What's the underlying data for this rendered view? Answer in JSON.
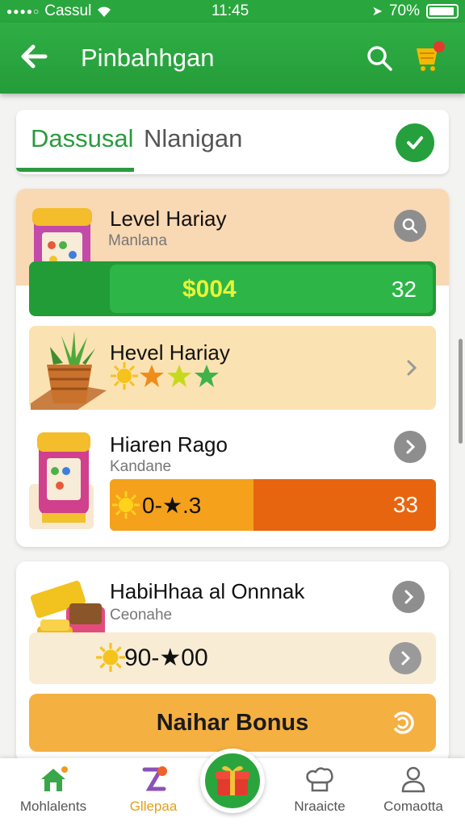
{
  "status_bar": {
    "carrier": "Cassul",
    "time": "11:45",
    "battery": "70%"
  },
  "app_bar": {
    "title": "Pinbahhgan",
    "icons": [
      "back-arrow-icon",
      "search-icon",
      "cart-icon"
    ]
  },
  "tabs": {
    "active": "Dassusal",
    "other": "Nlanigan"
  },
  "levels": [
    {
      "title": "Level Hariay",
      "subtitle": "Manlana",
      "amount": "$004",
      "count": "32"
    },
    {
      "title": "Hevel Hariay",
      "stars": 4
    },
    {
      "title": "Hiaren Rago",
      "subtitle": "Kandane",
      "reward": "0-★.3",
      "count": "33"
    }
  ],
  "offer": {
    "title": "HabiHhaa al Onnnak",
    "subtitle": "Ceonahe",
    "reward": "90-★00",
    "bonus_label": "Naihar Bonus"
  },
  "nav": {
    "items": [
      {
        "label": "Mohlalents",
        "icon": "home-icon"
      },
      {
        "label": "Gllepaa",
        "icon": "pin-icon"
      },
      {
        "label": "",
        "icon": "gift-icon"
      },
      {
        "label": "Nraaicte",
        "icon": "chef-hat-icon"
      },
      {
        "label": "Comaotta",
        "icon": "profile-icon"
      }
    ]
  },
  "colors": {
    "brand_green": "#2aa63e",
    "orange": "#e8650f",
    "accent_yellow": "#f5b042"
  }
}
